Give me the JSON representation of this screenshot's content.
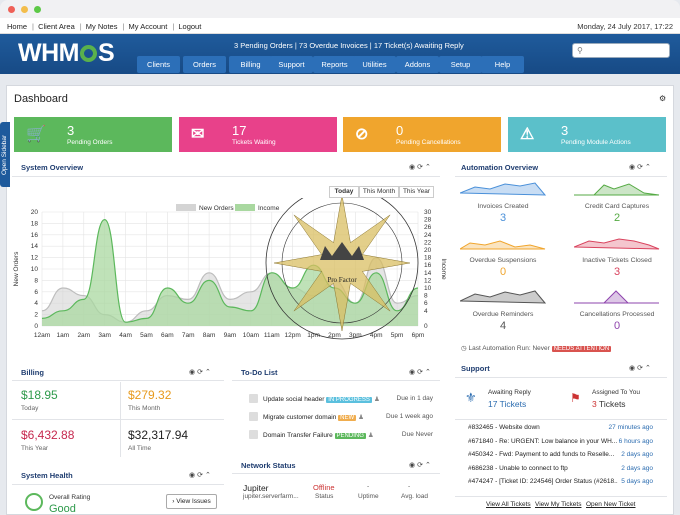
{
  "topbar": {
    "links": [
      "Home",
      "Client Area",
      "My Notes",
      "My Account",
      "Logout"
    ],
    "date": "Monday, 24 July 2017, 17:22"
  },
  "header": {
    "logo": "WHM​S",
    "logo_pre": "WHM",
    "logo_post": "S",
    "alert": {
      "pending": "3 Pending Orders",
      "overdue": "73 Overdue Invoices",
      "tickets": "17 Ticket(s) Awaiting Reply"
    },
    "search_placeholder": ""
  },
  "nav": [
    "Clients",
    "Orders",
    "Billing",
    "Support",
    "Reports",
    "Utilities",
    "Addons",
    "Setup",
    "Help"
  ],
  "page": {
    "title": "Dashboard",
    "sidebar_toggle": "Open Sidebar"
  },
  "stat_boxes": [
    {
      "value": "3",
      "label": "Pending Orders",
      "color": "#5cb85c",
      "icon": "cart-icon"
    },
    {
      "value": "17",
      "label": "Tickets Waiting",
      "color": "#e8418a",
      "icon": "chat-icon"
    },
    {
      "value": "0",
      "label": "Pending Cancellations",
      "color": "#f0a52d",
      "icon": "ban-icon"
    },
    {
      "value": "3",
      "label": "Pending Module Actions",
      "color": "#5bc0ca",
      "icon": "warning-icon"
    }
  ],
  "system_overview": {
    "title": "System Overview",
    "tabs": [
      "Today",
      "This Month",
      "This Year"
    ],
    "legend": [
      "New Orders",
      "Income"
    ],
    "ylabel": "New Orders",
    "y2label": "Income"
  },
  "chart_data": {
    "type": "area",
    "categories": [
      "12am",
      "1am",
      "2am",
      "3am",
      "4am",
      "5am",
      "6am",
      "7am",
      "8am",
      "9am",
      "10am",
      "11am",
      "12pm",
      "1pm",
      "2pm",
      "3pm",
      "4pm",
      "5pm",
      "6pm"
    ],
    "ylim": [
      0,
      30
    ],
    "y2lim": [
      0,
      30
    ],
    "yticks": [
      0,
      2,
      4,
      6,
      8,
      10,
      12,
      14,
      16,
      18,
      20
    ],
    "y2ticks": [
      0,
      4,
      6,
      8,
      10,
      12,
      14,
      16,
      18,
      20,
      22,
      24,
      26,
      28,
      30
    ],
    "series": [
      {
        "name": "New Orders",
        "values": [
          4,
          10,
          8,
          3,
          1,
          4,
          8,
          7,
          14,
          7,
          9,
          14,
          10,
          8,
          12,
          6,
          18,
          6,
          8
        ]
      },
      {
        "name": "Income",
        "values": [
          2,
          4,
          7,
          28,
          1,
          2,
          10,
          6,
          12,
          5,
          4,
          14,
          10,
          16,
          10,
          6,
          14,
          4,
          10
        ]
      }
    ],
    "grid": true,
    "legend": "top"
  },
  "watermark": {
    "text": "Pro Factor"
  },
  "billing": {
    "title": "Billing",
    "items": [
      {
        "value": "$18.95",
        "label": "Today",
        "color": "#2e9a4b"
      },
      {
        "value": "$279.32",
        "label": "This Month",
        "color": "#e79a1d"
      },
      {
        "value": "$6,432.88",
        "label": "This Year",
        "color": "#c6284e"
      },
      {
        "value": "$32,317.94",
        "label": "All Time",
        "color": "#222222"
      }
    ]
  },
  "todo": {
    "title": "To-Do List",
    "items": [
      {
        "text": "Update social header",
        "badge": "IN PROGRESS",
        "badge_color": "#5bc0de",
        "due": "Due in 1 day"
      },
      {
        "text": "Migrate customer domain",
        "badge": "NEW",
        "badge_color": "#f0ad4e",
        "due": "Due 1 week ago"
      },
      {
        "text": "Domain Transfer Failure",
        "badge": "PENDING",
        "badge_color": "#5cb85c",
        "due": "Due Never"
      }
    ]
  },
  "automation": {
    "title": "Automation Overview",
    "items": [
      {
        "label": "Invoices Created",
        "value": "3",
        "color": "#4a90d9"
      },
      {
        "label": "Credit Card Captures",
        "value": "2",
        "color": "#55aa44"
      },
      {
        "label": "Overdue Suspensions",
        "value": "0",
        "color": "#f0a52d"
      },
      {
        "label": "Inactive Tickets Closed",
        "value": "3",
        "color": "#d9435e"
      },
      {
        "label": "Overdue Reminders",
        "value": "4",
        "color": "#555555"
      },
      {
        "label": "Cancellations Processed",
        "value": "0",
        "color": "#8e44ad"
      }
    ],
    "last_run_label": "Last Automation Run: Never",
    "needs_attention": "NEEDS ATTENTION"
  },
  "support": {
    "title": "Support",
    "awaiting_label": "Awaiting Reply",
    "awaiting_value": "17 Tickets",
    "assigned_label": "Assigned To You",
    "assigned_value": "3",
    "assigned_suffix": "Tickets",
    "tickets": [
      {
        "text": "#832465 - Website down",
        "time": "27 minutes ago"
      },
      {
        "text": "#671840 - Re: URGENT: Low balance in your WH...",
        "time": "6 hours ago"
      },
      {
        "text": "#450342 - Fwd: Payment to add funds to Reselle...",
        "time": "2 days ago"
      },
      {
        "text": "#686238 - Unable to connect to ftp",
        "time": "2 days ago"
      },
      {
        "text": "#474247 - [Ticket ID: 224546] Order Status (#2618...",
        "time": "5 days ago"
      }
    ],
    "links": [
      "View All Tickets",
      "View My Tickets",
      "Open New Ticket"
    ]
  },
  "system_health": {
    "title": "System Health",
    "rating_label": "Overall Rating",
    "rating_value": "Good",
    "button": "View Issues"
  },
  "network": {
    "title": "Network Status",
    "server": "Jupiter",
    "host": "jupiter.serverfarm...",
    "status": "Offline",
    "status_label": "Status",
    "uptime": "-",
    "uptime_label": "Uptime",
    "load": "-",
    "load_label": "Avg. load"
  }
}
